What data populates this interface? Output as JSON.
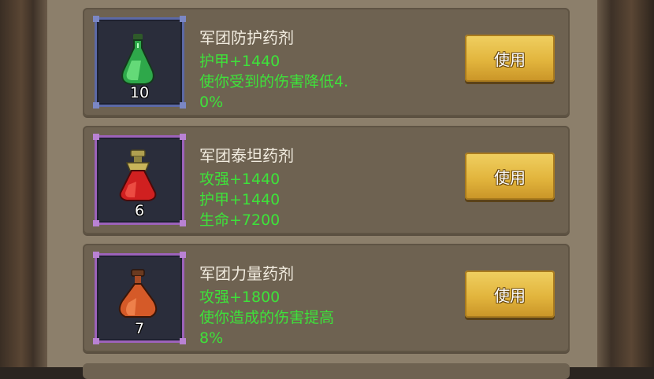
{
  "items": [
    {
      "name": "军团防护药剂",
      "count": "10",
      "desc_lines": [
        "护甲+1440",
        "使你受到的伤害降低4.",
        "0%"
      ],
      "button_label": "使用",
      "icon": "green-potion-icon",
      "frame_color": "#5c69a6"
    },
    {
      "name": "军团泰坦药剂",
      "count": "6",
      "desc_lines": [
        "攻强+1440",
        "护甲+1440",
        "生命+7200"
      ],
      "button_label": "使用",
      "icon": "red-potion-icon",
      "frame_color": "#9c62ba"
    },
    {
      "name": "军团力量药剂",
      "count": "7",
      "desc_lines": [
        "攻强+1800",
        "使你造成的伤害提高",
        "8%"
      ],
      "button_label": "使用",
      "icon": "orange-potion-icon",
      "frame_color": "#9c62ba"
    }
  ],
  "colors": {
    "stat_text": "#3ee23a",
    "button": "#e2b53d",
    "card_bg": "#6e6251"
  }
}
